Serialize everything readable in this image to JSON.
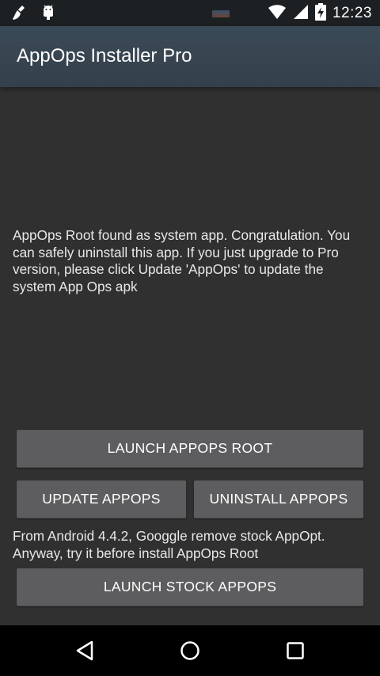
{
  "status_bar": {
    "time": "12:23",
    "icons": [
      "broom-icon",
      "android-bug-icon",
      "notification-thumbnail-icon",
      "wifi-icon",
      "signal-icon",
      "battery-charging-icon"
    ]
  },
  "app_bar": {
    "title": "AppOps Installer Pro"
  },
  "main": {
    "message": "AppOps Root found as system app. Congratulation. You can safely uninstall this app. If you just upgrade to Pro version, please click Update 'AppOps' to update the system App Ops apk",
    "launch_root_label": "LAUNCH APPOPS ROOT",
    "update_label": "UPDATE APPOPS",
    "uninstall_label": "UNINSTALL APPOPS",
    "note": "From Android 4.4.2, Googgle remove stock AppOpt. Anyway, try it before install AppOps Root",
    "launch_stock_label": "LAUNCH STOCK APPOPS"
  },
  "nav_bar": {
    "icons": [
      "back-icon",
      "home-icon",
      "recents-icon"
    ]
  },
  "colors": {
    "status_bar": "#1c2023",
    "app_bar": "#37434e",
    "background": "#303030",
    "button": "#5d5d5f",
    "nav_bar": "#000000"
  }
}
